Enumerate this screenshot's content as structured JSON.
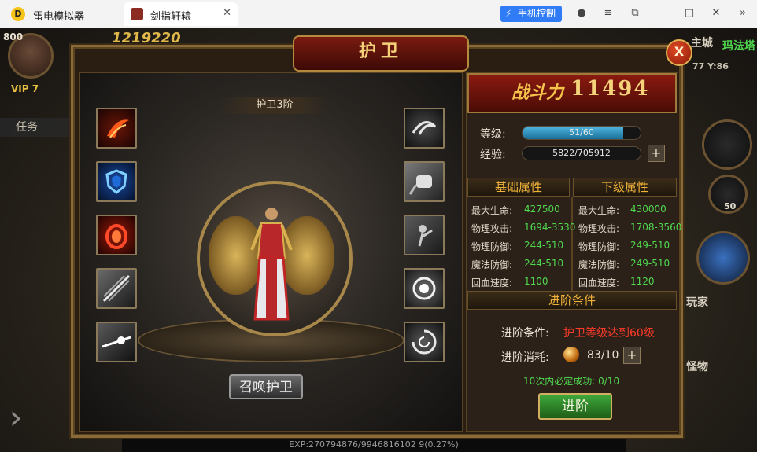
{
  "emulator": {
    "app_name": "雷电模拟器",
    "tab_label": "剑指轩辕",
    "tab_close": "✕",
    "phone_control": "手机控制",
    "window_controls": [
      "user-icon",
      "menu-icon",
      "restore-icon",
      "minimize-icon",
      "maximize-icon",
      "close-icon",
      "expand-icon"
    ]
  },
  "hud": {
    "level_badge": "800",
    "combat_power_total": "1219220",
    "vip": "VIP 7",
    "task_tab": "任务",
    "right_label_1": "主城",
    "right_label_2": "玛法塔",
    "coords": "77 Y:86",
    "right_hint_1": "玩家",
    "right_hint_2": "怪物",
    "right_count": "50",
    "exp_text": "EXP:270794876/9946816102 9(0.27%)"
  },
  "panel": {
    "title": "护卫",
    "close_label": "X",
    "stage_title": "护卫3阶",
    "summon_label": "召唤护卫",
    "left_skills": [
      "fire-slash-icon",
      "ice-shield-icon",
      "flame-guard-icon",
      "blade-storm-icon",
      "light-strike-icon"
    ],
    "right_skills": [
      "whirlwind-icon",
      "power-fist-icon",
      "warrior-strike-icon",
      "energy-sphere-icon",
      "spin-vortex-icon"
    ],
    "combat_power_label": "战斗力",
    "combat_power_value": "11494",
    "level_label": "等级:",
    "level_value": "51/60",
    "level_progress": 0.85,
    "exp_label": "经验:",
    "exp_value": "5822/705912",
    "exp_progress": 0.008,
    "plus": "+",
    "basic_header": "基础属性",
    "next_header": "下级属性",
    "basic_attrs": [
      {
        "name": "最大生命:",
        "value": "427500"
      },
      {
        "name": "物理攻击:",
        "value": "1694-3530"
      },
      {
        "name": "物理防御:",
        "value": "244-510"
      },
      {
        "name": "魔法防御:",
        "value": "244-510"
      },
      {
        "name": "回血速度:",
        "value": "1100"
      }
    ],
    "next_attrs": [
      {
        "name": "最大生命:",
        "value": "430000"
      },
      {
        "name": "物理攻击:",
        "value": "1708-3560"
      },
      {
        "name": "物理防御:",
        "value": "249-510"
      },
      {
        "name": "魔法防御:",
        "value": "249-510"
      },
      {
        "name": "回血速度:",
        "value": "1120"
      }
    ],
    "advance_header": "进阶条件",
    "cond_label": "进阶条件:",
    "cond_value": "护卫等级达到60级",
    "cost_label": "进阶消耗:",
    "cost_value": "83/10",
    "guarantee_text": "10次内必定成功: 0/10",
    "advance_btn": "进阶"
  },
  "colors": {
    "panel_gold": "#a8884a",
    "power_gold": "#f4d27a",
    "attr_green": "#4fd84f",
    "cond_red": "#ff3a2a",
    "header_orange": "#f0b23a"
  }
}
